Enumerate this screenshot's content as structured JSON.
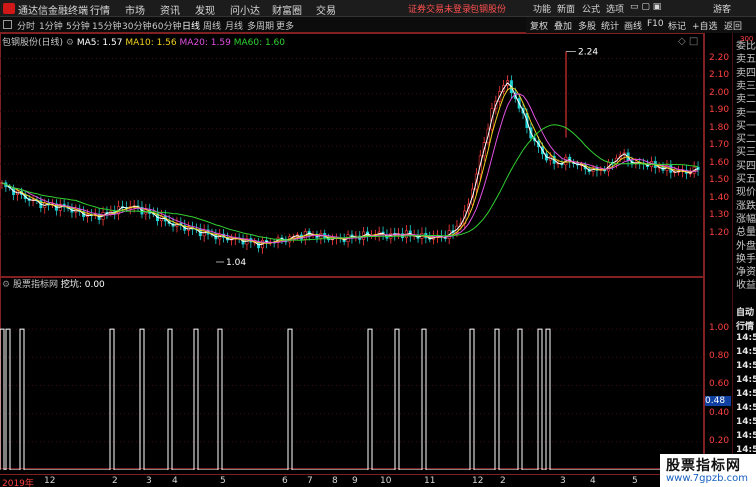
{
  "titlebar": {
    "app_title": "通达信金融终端",
    "menus": [
      "行情",
      "市场",
      "资讯",
      "发现",
      "问小达",
      "财富圈",
      "交易"
    ],
    "tip": "证券交易未登录",
    "tip2": "包钢股份",
    "right_menus": [
      "功能",
      "新面",
      "公式",
      "选项"
    ],
    "guest": "游客"
  },
  "periods": [
    "分时",
    "1分钟",
    "5分钟",
    "15分钟",
    "30分钟",
    "60分钟",
    "日线",
    "周线",
    "月线",
    "多周期",
    "更多"
  ],
  "active_period": "日线",
  "toolbar": [
    "复权",
    "叠加",
    "多股",
    "统计",
    "画线",
    "F10",
    "标记",
    "+自选",
    "返回"
  ],
  "main_legend": {
    "name": "包钢股份(日线)",
    "items": [
      {
        "label": "MA5: 1.57",
        "color": "#ffffff"
      },
      {
        "label": "MA10: 1.56",
        "color": "#f0d020"
      },
      {
        "label": "MA20: 1.59",
        "color": "#e050e0"
      },
      {
        "label": "MA60: 1.60",
        "color": "#30d030"
      }
    ]
  },
  "indicator_legend": {
    "name": "股票指标网",
    "value": "挖坑: 0.00"
  },
  "price_axis": {
    "labels": [
      "2.20",
      "2.10",
      "2.00",
      "1.90",
      "1.80",
      "1.70",
      "1.60",
      "1.50",
      "1.40",
      "1.30",
      "1.20"
    ],
    "top_label": "300"
  },
  "indicator_axis": {
    "labels": [
      "1.00",
      "0.80",
      "0.60",
      "0.40",
      "0.20"
    ],
    "current": "0.48"
  },
  "side_panel": {
    "top": [
      "委比",
      "卖五",
      "卖四",
      "卖三",
      "卖二",
      "卖一",
      "买一",
      "买二",
      "买三",
      "买四",
      "买五",
      "现价",
      "涨跌",
      "涨幅",
      "总量",
      "外盘",
      "换手",
      "净资",
      "收益"
    ],
    "bottom": [
      "自动",
      "行情",
      "14:5",
      "14:5",
      "14:5",
      "14:5",
      "14:5",
      "14:5",
      "14:5",
      "14:5",
      "14:5",
      "14:5"
    ]
  },
  "annotations": {
    "high": "2.24",
    "low": "1.04"
  },
  "date_axis": [
    "2019年",
    "12",
    "2",
    "3",
    "4",
    "5",
    "6",
    "7",
    "8",
    "9",
    "10",
    "11",
    "12",
    "2",
    "3",
    "4",
    "5"
  ],
  "watermark": {
    "line1": "股票指标网",
    "line2": "www.7gpzb.com"
  },
  "chart_data": [
    {
      "type": "candlestick",
      "title": "包钢股份(日线)",
      "ylim": [
        1.0,
        2.3
      ],
      "ma": {
        "MA5": 1.57,
        "MA10": 1.56,
        "MA20": 1.59,
        "MA60": 1.6
      },
      "close_path": [
        1.48,
        1.44,
        1.4,
        1.37,
        1.36,
        1.35,
        1.32,
        1.3,
        1.31,
        1.34,
        1.36,
        1.33,
        1.3,
        1.26,
        1.24,
        1.22,
        1.2,
        1.18,
        1.17,
        1.16,
        1.14,
        1.16,
        1.17,
        1.19,
        1.2,
        1.18,
        1.17,
        1.18,
        1.19,
        1.2,
        1.19,
        1.2,
        1.19,
        1.18,
        1.18,
        1.21,
        1.32,
        1.6,
        1.9,
        2.08,
        1.95,
        1.76,
        1.65,
        1.6,
        1.62,
        1.58,
        1.56,
        1.58,
        1.66,
        1.6,
        1.6,
        1.58,
        1.56,
        1.55,
        1.57
      ]
    },
    {
      "type": "line",
      "title": "挖坑",
      "ylim": [
        0,
        1.1
      ],
      "spike_positions": [
        2,
        8,
        22,
        112,
        142,
        170,
        196,
        220,
        290,
        370,
        397,
        424,
        472,
        497,
        520,
        540,
        548
      ],
      "value": 0.0
    }
  ]
}
